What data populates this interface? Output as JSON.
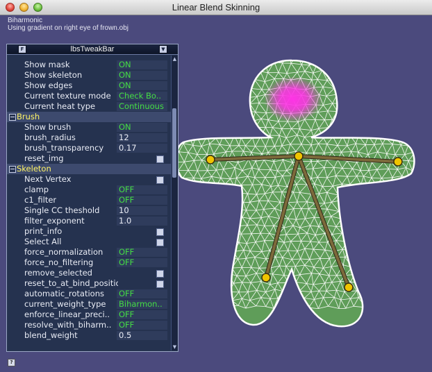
{
  "window": {
    "title": "Linear Blend Skinning"
  },
  "info_lines": [
    "Biharmonic",
    "Using gradient on right eye of frown.obj"
  ],
  "tweakbar": {
    "title": "lbsTweakBar",
    "left_button": "F",
    "right_button": "▼",
    "scroll_up": "▲",
    "scroll_down": "▼",
    "rows": [
      {
        "kind": "value",
        "label": "Show mask",
        "value": "ON",
        "type": "on"
      },
      {
        "kind": "value",
        "label": "Show skeleton",
        "value": "ON",
        "type": "on"
      },
      {
        "kind": "value",
        "label": "Show edges",
        "value": "ON",
        "type": "on"
      },
      {
        "kind": "value",
        "label": "Current texture mode",
        "value": "Check Bo..",
        "type": "on"
      },
      {
        "kind": "value",
        "label": "Current heat type",
        "value": "Continuous",
        "type": "on"
      },
      {
        "kind": "group",
        "label": "Brush"
      },
      {
        "kind": "value",
        "label": "Show brush",
        "value": "ON",
        "type": "on"
      },
      {
        "kind": "value",
        "label": "brush_radius",
        "value": "12",
        "type": "num"
      },
      {
        "kind": "value",
        "label": "brush_transparency",
        "value": "0.17",
        "type": "num"
      },
      {
        "kind": "button",
        "label": "reset_img"
      },
      {
        "kind": "group",
        "label": "Skeleton"
      },
      {
        "kind": "button",
        "label": "Next Vertex"
      },
      {
        "kind": "value",
        "label": "clamp",
        "value": "OFF",
        "type": "on"
      },
      {
        "kind": "value",
        "label": "c1_filter",
        "value": "OFF",
        "type": "on"
      },
      {
        "kind": "value",
        "label": "Single CC theshold",
        "value": "10",
        "type": "num"
      },
      {
        "kind": "value",
        "label": "filter_exponent",
        "value": "1.0",
        "type": "num"
      },
      {
        "kind": "button",
        "label": "print_info"
      },
      {
        "kind": "button",
        "label": "Select All"
      },
      {
        "kind": "value",
        "label": "force_normalization",
        "value": "OFF",
        "type": "on"
      },
      {
        "kind": "value",
        "label": "force_no_filtering",
        "value": "OFF",
        "type": "on"
      },
      {
        "kind": "button",
        "label": "remove_selected"
      },
      {
        "kind": "button",
        "label": "reset_to_at_bind_positions"
      },
      {
        "kind": "value",
        "label": "automatic_rotations",
        "value": "OFF",
        "type": "on"
      },
      {
        "kind": "value",
        "label": "current_weight_type",
        "value": "Biharmon..",
        "type": "on"
      },
      {
        "kind": "value",
        "label": "enforce_linear_preci..",
        "value": "OFF",
        "type": "on"
      },
      {
        "kind": "value",
        "label": "resolve_with_biharm..",
        "value": "OFF",
        "type": "on"
      },
      {
        "kind": "value",
        "label": "blend_weight",
        "value": "0.5",
        "type": "num"
      }
    ]
  },
  "help_button": "?",
  "colors": {
    "background": "#4b4a7d",
    "mesh_fill": "#5f9d59",
    "mesh_edges": "#ffffff",
    "bone": "#7d6a3b",
    "joint": "#f0c400",
    "heat": "#ff33e6"
  }
}
